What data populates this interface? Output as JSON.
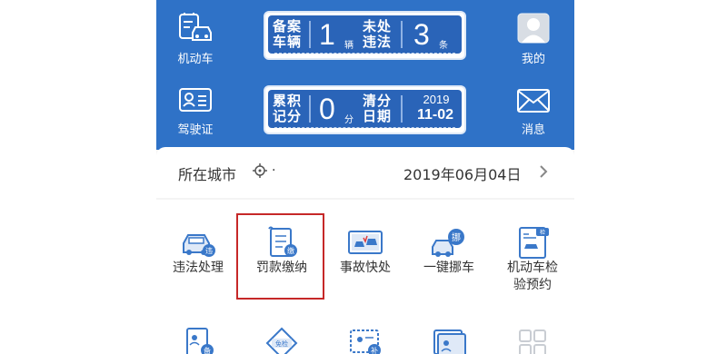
{
  "header": {
    "vehicle_label": "机动车",
    "license_label": "驾驶证",
    "profile_label": "我的",
    "messages_label": "消息"
  },
  "panel_top": {
    "left_label_line1": "备案",
    "left_label_line2": "车辆",
    "left_value": "1",
    "left_unit": "辆",
    "right_label_line1": "未处",
    "right_label_line2": "违法",
    "right_value": "3",
    "right_unit": "条"
  },
  "panel_bottom": {
    "left_label_line1": "累积",
    "left_label_line2": "记分",
    "left_value": "0",
    "left_unit": "分",
    "right_label_line1": "清分",
    "right_label_line2": "日期",
    "year": "2019",
    "month_day": "11-02"
  },
  "location_bar": {
    "city_label": "所在城市",
    "city_value": ".",
    "date": "2019年06月04日"
  },
  "services": [
    {
      "label": "违法处理",
      "icon": "car-violation-icon",
      "badge": "违"
    },
    {
      "label": "罚款缴纳",
      "icon": "fine-payment-icon",
      "badge": "缴"
    },
    {
      "label": "事故快处",
      "icon": "accident-icon"
    },
    {
      "label": "一键挪车",
      "icon": "move-car-icon",
      "badge": "挪"
    },
    {
      "label": "机动车检\n验预约",
      "icon": "inspection-icon",
      "badge": "检"
    }
  ],
  "services_row2": [
    {
      "icon": "record-icon",
      "badge": "备"
    },
    {
      "icon": "exempt-inspection-icon",
      "badge": "免检"
    },
    {
      "icon": "reissue-icon",
      "badge": "补"
    },
    {
      "icon": "license-card-icon"
    },
    {
      "icon": "more-grid-icon"
    }
  ],
  "colors": {
    "header_blue": "#2f72c7",
    "panel_blue": "#2a64b8",
    "highlight_red": "#c62828",
    "icon_blue": "#3a78c9"
  }
}
